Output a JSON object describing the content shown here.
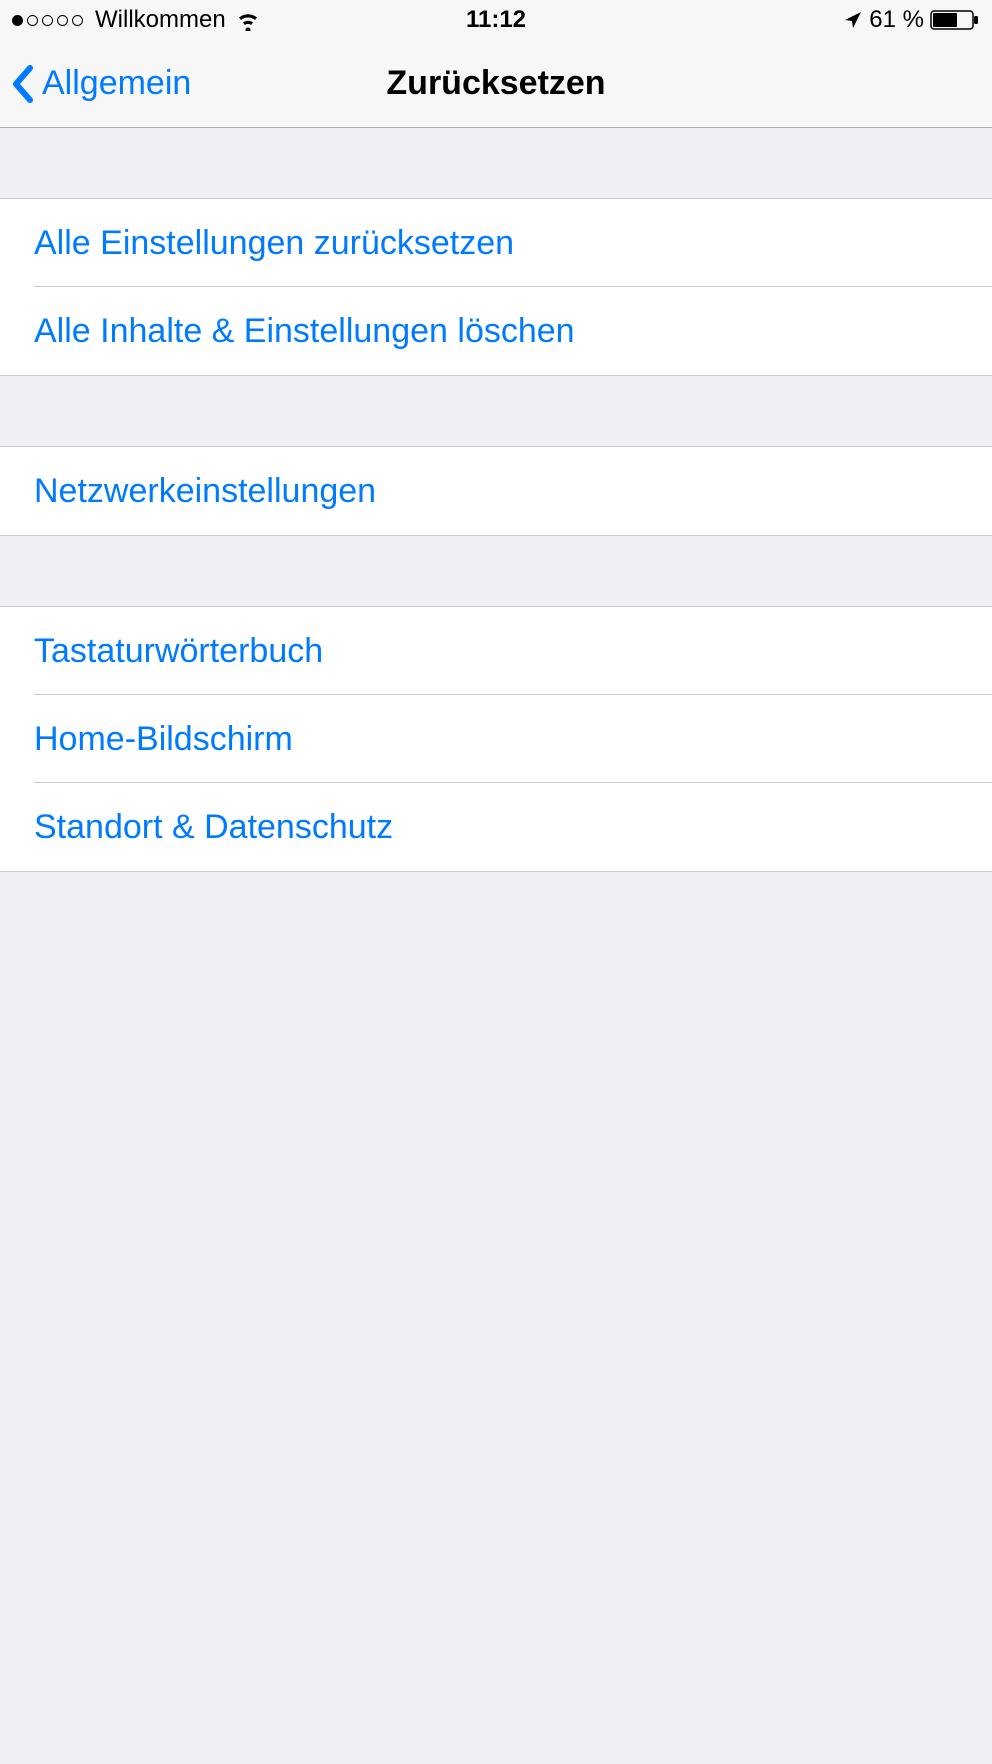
{
  "status": {
    "carrier": "Willkommen",
    "time": "11:12",
    "battery_percent": "61 %",
    "signal_strength": 1
  },
  "nav": {
    "back_label": "Allgemein",
    "title": "Zurücksetzen"
  },
  "sections": [
    {
      "items": [
        {
          "label": "Alle Einstellungen zurücksetzen"
        },
        {
          "label": "Alle Inhalte & Einstellungen löschen"
        }
      ]
    },
    {
      "items": [
        {
          "label": "Netzwerkeinstellungen"
        }
      ]
    },
    {
      "items": [
        {
          "label": "Tastaturwörterbuch"
        },
        {
          "label": "Home-Bildschirm"
        },
        {
          "label": "Standort & Datenschutz"
        }
      ]
    }
  ]
}
